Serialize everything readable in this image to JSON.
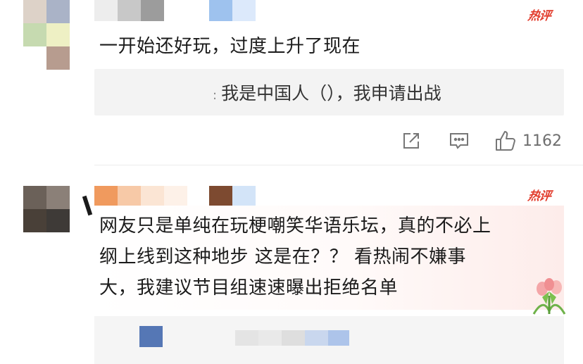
{
  "comments": [
    {
      "badge": "热评",
      "text": "一开始还好玩，过度上升了现在",
      "quote": "我是中国人（），我申请出战",
      "quote_prefix": ":",
      "actions": {
        "share_icon": "share-icon",
        "comment_icon": "comment-icon",
        "like_icon": "thumbs-up-icon",
        "like_count": "1162"
      }
    },
    {
      "badge": "热评",
      "lines": [
        "网友只是单纯在玩梗嘲笑华语乐坛，真的不必上",
        "纲上线到这种地步 这是在？？ 看热闹不嫌事",
        "大，我建议节目组速速曝出拒绝名单"
      ]
    }
  ],
  "colors": {
    "hot_badge": "#e23c2c",
    "text": "#1b1b1b",
    "quote_bg": "#f3f3f3"
  }
}
